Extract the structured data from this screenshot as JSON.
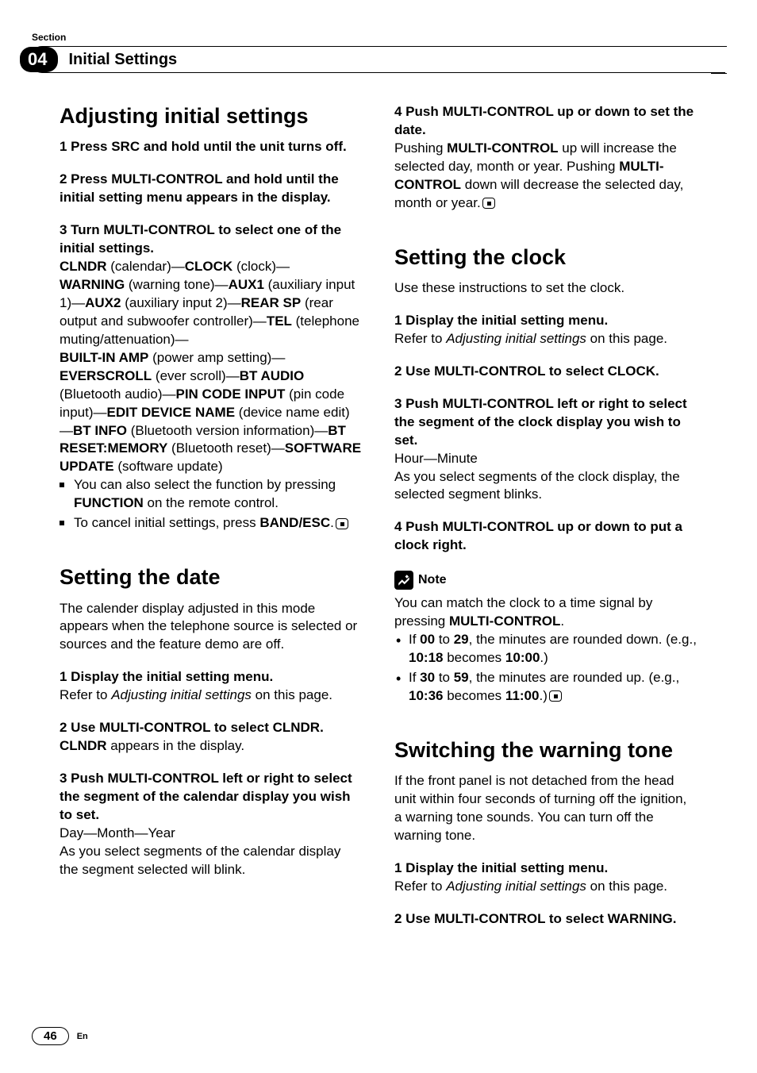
{
  "header": {
    "section_label": "Section",
    "section_number": "04",
    "chapter_title": "Initial Settings"
  },
  "left_column": {
    "h1_adjusting": "Adjusting initial settings",
    "adj_step1": "1    Press SRC and hold until the unit turns off.",
    "adj_step2": "2    Press MULTI-CONTROL and hold until the initial setting menu appears in the display.",
    "adj_step3_head": "3    Turn MULTI-CONTROL to select one of the initial settings.",
    "options": {
      "clndr": "CLNDR",
      "clndr_desc": " (calendar)—",
      "clock": "CLOCK",
      "clock_desc": " (clock)—",
      "warning": "WARNING",
      "warning_desc": " (warning tone)—",
      "aux1": "AUX1",
      "aux1_desc": " (auxiliary input 1)—",
      "aux2": "AUX2",
      "aux2_desc": " (auxiliary input 2)—",
      "rearsp": "REAR SP",
      "rearsp_desc": " (rear output and subwoofer controller)—",
      "tel": "TEL",
      "tel_desc": " (telephone muting/attenuation)—",
      "builtinamp": "BUILT-IN AMP",
      "builtinamp_desc": " (power amp setting)—",
      "everscroll": "EVERSCROLL",
      "everscroll_desc": " (ever scroll)—",
      "btaudio": "BT AUDIO",
      "btaudio_desc": " (Bluetooth audio)—",
      "pincode": "PIN CODE INPUT",
      "pincode_desc": " (pin code input)—",
      "editdevice": "EDIT DEVICE NAME",
      "editdevice_desc": " (device name edit)—",
      "btinfo": "BT INFO",
      "btinfo_desc": " (Bluetooth version information)—",
      "btreset": "BT RESET:MEMORY",
      "btreset_desc": " (Bluetooth reset)—",
      "software": "SOFTWARE UPDATE",
      "software_desc": " (software update)"
    },
    "note_func_pre": "You can also select the function by pressing ",
    "note_func_bold": "FUNCTION",
    "note_func_post": " on the remote control.",
    "note_cancel_pre": "To cancel initial settings, press ",
    "note_cancel_bold": "BAND/ESC",
    "note_cancel_post": ".",
    "h1_date": "Setting the date",
    "date_intro": "The calender display adjusted in this mode appears when the telephone source is selected or sources and the feature demo are off.",
    "date_step1_head": "1    Display the initial setting menu.",
    "date_step1_body_pre": "Refer to ",
    "date_step1_body_italic": "Adjusting initial settings",
    "date_step1_body_post": " on this page.",
    "date_step2_head": "2    Use MULTI-CONTROL to select CLNDR.",
    "date_step2_body_bold": "CLNDR",
    "date_step2_body_post": " appears in the display.",
    "date_step3_head": "3    Push MULTI-CONTROL left or right to select the segment of the calendar display you wish to set.",
    "date_step3_body1": "Day—Month—Year",
    "date_step3_body2": "As you select segments of the calendar display the segment selected will blink."
  },
  "right_column": {
    "date_step4_head": "4    Push MULTI-CONTROL up or down to set the date.",
    "date_step4_body_p1": "Pushing ",
    "date_step4_body_b1": "MULTI-CONTROL",
    "date_step4_body_p2": " up will increase the selected day, month or year. Pushing ",
    "date_step4_body_b2": "MULTI-CONTROL",
    "date_step4_body_p3": " down will decrease the selected day, month or year.",
    "h1_clock": "Setting the clock",
    "clock_intro": "Use these instructions to set the clock.",
    "clock_step1_head": "1    Display the initial setting menu.",
    "clock_step1_body_pre": "Refer to ",
    "clock_step1_body_italic": "Adjusting initial settings",
    "clock_step1_body_post": " on this page.",
    "clock_step2_head": "2    Use MULTI-CONTROL to select CLOCK.",
    "clock_step3_head": "3    Push MULTI-CONTROL left or right to select the segment of the clock display you wish to set.",
    "clock_step3_body1": "Hour—Minute",
    "clock_step3_body2": "As you select segments of the clock display, the selected segment blinks.",
    "clock_step4_head": "4    Push MULTI-CONTROL up or down to put a clock right.",
    "note_label": "Note",
    "note_body_p1": "You can match the clock to a time signal by pressing ",
    "note_body_b1": "MULTI-CONTROL",
    "note_body_p2": ".",
    "note_li1_p1": "If ",
    "note_li1_b1": "00",
    "note_li1_p2": " to ",
    "note_li1_b2": "29",
    "note_li1_p3": ", the minutes are rounded down. (e.g., ",
    "note_li1_b3": "10:18",
    "note_li1_p4": " becomes ",
    "note_li1_b4": "10:00",
    "note_li1_p5": ".)",
    "note_li2_p1": "If ",
    "note_li2_b1": "30",
    "note_li2_p2": " to ",
    "note_li2_b2": "59",
    "note_li2_p3": ", the minutes are rounded up. (e.g., ",
    "note_li2_b3": "10:36",
    "note_li2_p4": " becomes ",
    "note_li2_b4": "11:00",
    "note_li2_p5": ".)",
    "h1_warning": "Switching the warning tone",
    "warning_intro": "If the front panel is not detached from the head unit within four seconds of turning off the ignition, a warning tone sounds. You can turn off the warning tone.",
    "warning_step1_head": "1    Display the initial setting menu.",
    "warning_step1_body_pre": "Refer to ",
    "warning_step1_body_italic": "Adjusting initial settings",
    "warning_step1_body_post": " on this page.",
    "warning_step2_head": "2    Use MULTI-CONTROL to select WARNING."
  },
  "footer": {
    "page": "46",
    "lang": "En"
  }
}
